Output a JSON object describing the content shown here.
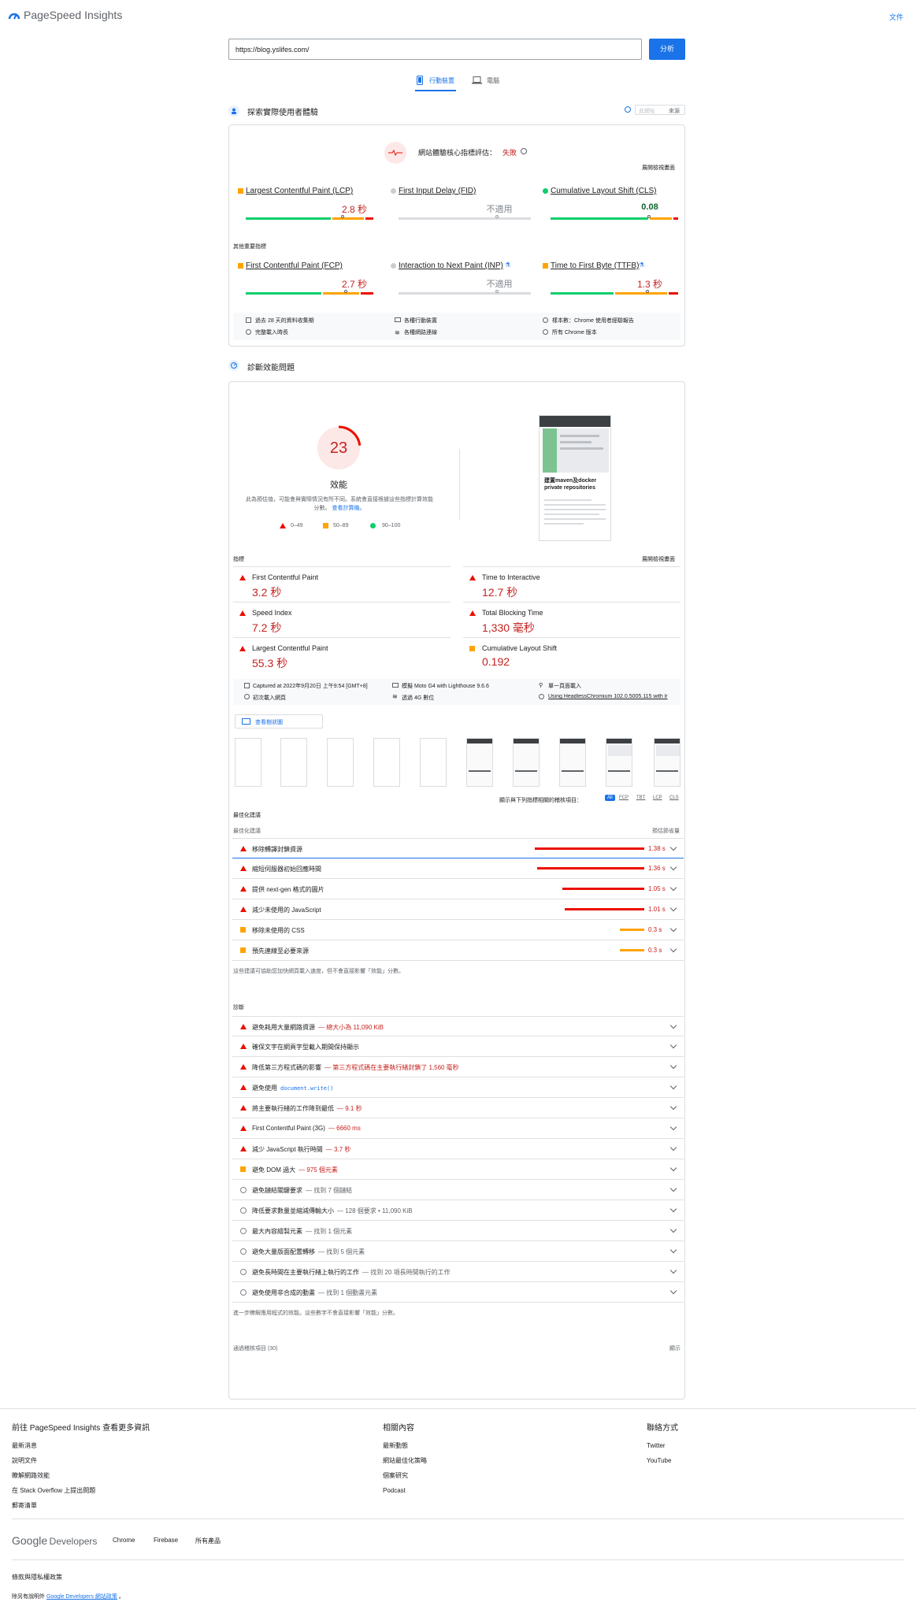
{
  "header": {
    "logo_text": "PageSpeed Insights",
    "docs_link": "文件"
  },
  "search": {
    "url": "https://blog.yslifes.com/",
    "analyze_label": "分析"
  },
  "tabs": [
    {
      "label": "行動裝置",
      "active": true
    },
    {
      "label": "電腦",
      "active": false
    }
  ],
  "field": {
    "title": "探索實際使用者體驗",
    "toggle": {
      "this_url": "此網址",
      "origin": "來源"
    },
    "cwv_label": "網站體驗核心指標評估：",
    "cwv_result": "失敗",
    "expand_view": "展開檢視畫面",
    "metrics": [
      {
        "name": "Largest Contentful Paint (LCP)",
        "value": "2.8 秒",
        "status": "average"
      },
      {
        "name": "First Input Delay (FID)",
        "value": "不適用",
        "status": "na"
      },
      {
        "name": "Cumulative Layout Shift (CLS)",
        "value": "0.08",
        "status": "good"
      }
    ],
    "other_label": "其他重要指標",
    "other_metrics": [
      {
        "name": "First Contentful Paint (FCP)",
        "value": "2.7 秒",
        "status": "average"
      },
      {
        "name": "Interaction to Next Paint (INP)",
        "value": "不適用",
        "status": "na"
      },
      {
        "name": "Time to First Byte (TTFB)",
        "value": "1.3 秒",
        "status": "average"
      }
    ],
    "info": [
      "過去 28 天的資料收集期",
      "各種行動裝置",
      "樣本數：Chrome 使用者經驗報告",
      "完整載入時長",
      "各種網路連線",
      "所有 Chrome 版本"
    ]
  },
  "lab": {
    "title": "診斷效能問題",
    "score": "23",
    "score_value": 23,
    "score_label": "效能",
    "score_note": "此為預估值，可能會與實際情況有所不同。系統會直接根據這些指標計算效能分數。",
    "score_note_link": "查看計算機。",
    "legend": [
      {
        "range": "0–49"
      },
      {
        "range": "50–89"
      },
      {
        "range": "90–100"
      }
    ],
    "screenshot_title": "建置maven及docker private repositories",
    "metrics_label": "指標",
    "expand_view": "展開檢視畫面",
    "metrics": [
      {
        "name": "First Contentful Paint",
        "value": "3.2 秒",
        "status": "fail"
      },
      {
        "name": "Time to Interactive",
        "value": "12.7 秒",
        "status": "fail"
      },
      {
        "name": "Speed Index",
        "value": "7.2 秒",
        "status": "fail"
      },
      {
        "name": "Total Blocking Time",
        "value": "1,330 毫秒",
        "status": "fail"
      },
      {
        "name": "Largest Contentful Paint",
        "value": "55.3 秒",
        "status": "fail"
      },
      {
        "name": "Cumulative Layout Shift",
        "value": "0.192",
        "status": "average"
      }
    ],
    "env": [
      "Captured at 2022年9月20日 上午9:54 [GMT+8]",
      "模擬 Moto G4 with Lighthouse 9.6.6",
      "單一頁面載入",
      "初次載入網頁",
      "透過 4G 數位",
      "Using HeadlessChromium 102.0.5005.115 with lr"
    ],
    "treemap_label": "查看樹狀圖",
    "filter_label": "顯示與下列指標相關的稽核項目：",
    "filters": [
      "All",
      "FCP",
      "TBT",
      "LCP",
      "CLS"
    ]
  },
  "opportunities": {
    "section_label": "最佳化建議",
    "col_label": "最佳化建議",
    "col_savings": "預估節省量",
    "items": [
      {
        "title": "移除轉譯封鎖資源",
        "saving": "1.38 s",
        "bar": 0.99,
        "type": "fail"
      },
      {
        "title": "縮短伺服器初始回應時間",
        "saving": "1.36 s",
        "bar": 0.97,
        "type": "fail"
      },
      {
        "title": "提供 next-gen 格式的圖片",
        "saving": "1.05 s",
        "bar": 0.74,
        "type": "fail"
      },
      {
        "title": "減少未使用的 JavaScript",
        "saving": "1.01 s",
        "bar": 0.72,
        "type": "fail"
      },
      {
        "title": "移除未使用的 CSS",
        "saving": "0.3 s",
        "bar": 0.22,
        "type": "average"
      },
      {
        "title": "預先連線至必要來源",
        "saving": "0.3 s",
        "bar": 0.22,
        "type": "average"
      }
    ],
    "note": "這些建議可協助您加快網頁載入速度，但不會直接影響「效能」分數。"
  },
  "diagnostics": {
    "label": "診斷",
    "items": [
      {
        "title": "避免耗用大量網路資源",
        "detail": "— 總大小為 11,090 KiB",
        "type": "fail"
      },
      {
        "title": "確保文字在網頁字型載入期間保持顯示",
        "detail": "",
        "type": "fail"
      },
      {
        "title": "降低第三方程式碼的影響",
        "detail": "— 第三方程式碼在主要執行緒封鎖了 1,560 毫秒",
        "type": "fail"
      },
      {
        "title": "避免使用",
        "detail": "document.write()",
        "type": "fail",
        "code": true
      },
      {
        "title": "將主要執行緒的工作降到最低",
        "detail": "— 9.1 秒",
        "type": "fail"
      },
      {
        "title": "First Contentful Paint (3G)",
        "detail": "— 6660 ms",
        "type": "fail"
      },
      {
        "title": "減少 JavaScript 執行時間",
        "detail": "— 3.7 秒",
        "type": "fail"
      },
      {
        "title": "避免 DOM 過大",
        "detail": "— 975 個元素",
        "type": "average"
      },
      {
        "title": "避免鏈結關鍵要求",
        "detail": "— 找到 7 個鏈結",
        "type": "info"
      },
      {
        "title": "降低要求數量並縮減傳輸大小",
        "detail": "— 128 個要求 • 11,090 KiB",
        "type": "info"
      },
      {
        "title": "最大內容繪製元素",
        "detail": "— 找到 1 個元素",
        "type": "info"
      },
      {
        "title": "避免大量版面配置轉移",
        "detail": "— 找到 5 個元素",
        "type": "info"
      },
      {
        "title": "避免長時間在主要執行緒上執行的工作",
        "detail": "— 找到 20 項長時間執行的工作",
        "type": "info"
      },
      {
        "title": "避免使用非合成的動畫",
        "detail": "— 找到 1 個動畫元素",
        "type": "info"
      }
    ],
    "note": "進一步瞭解應用程式的效能。這些數字不會直接影響「效能」分數。"
  },
  "passed": {
    "label": "通過稽核項目 (30)",
    "show": "顯示"
  },
  "footer": {
    "col1_title": "前往 PageSpeed Insights 查看更多資訊",
    "col1": [
      "最新消息",
      "說明文件",
      "瞭解網路效能",
      "在 Stack Overflow 上提出問題",
      "郵寄清單"
    ],
    "col2_title": "相關內容",
    "col2": [
      "最新動態",
      "網站最佳化策略",
      "個案研究",
      "Podcast"
    ],
    "col3_title": "聯絡方式",
    "col3": [
      "Twitter",
      "YouTube"
    ],
    "brand_google": "Google",
    "brand_dev": "Developers",
    "brand_links": [
      "Chrome",
      "Firebase",
      "所有產品"
    ],
    "terms": "條款與隱私權政策",
    "note_prefix": "除另有說明外",
    "note_link": "Google Developers 網站政策",
    "note_suffix": "。"
  },
  "colors": {
    "fail": "#eb0f00",
    "average": "#ffa400",
    "good": "#0cce6b",
    "accent": "#1a73e8"
  }
}
